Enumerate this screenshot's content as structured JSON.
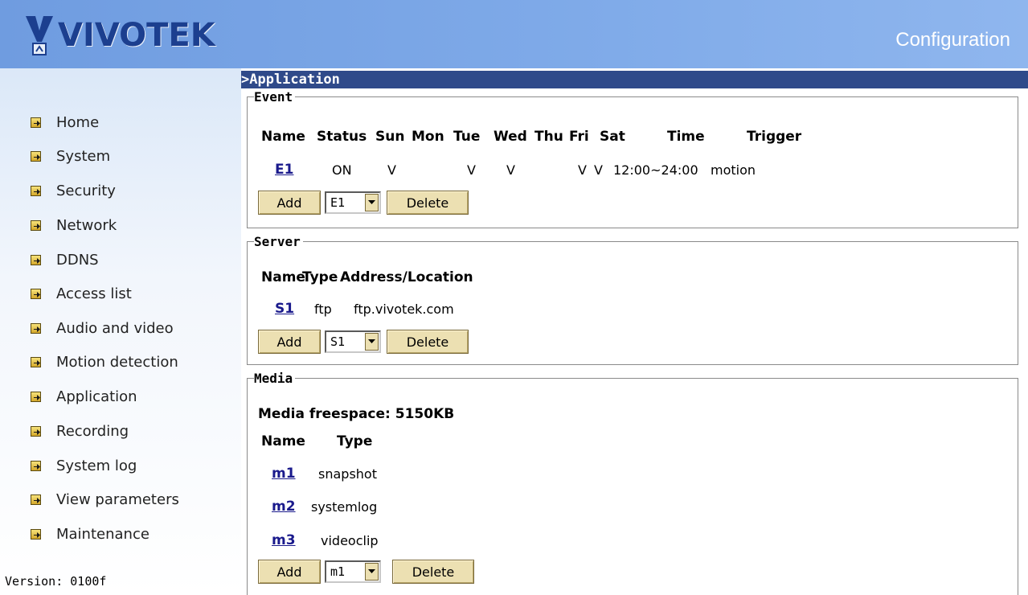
{
  "header": {
    "brand": "VIVOTEK",
    "title": "Configuration"
  },
  "sidebar": {
    "items": [
      {
        "label": "Home"
      },
      {
        "label": "System"
      },
      {
        "label": "Security"
      },
      {
        "label": "Network"
      },
      {
        "label": "DDNS"
      },
      {
        "label": "Access list"
      },
      {
        "label": "Audio and video"
      },
      {
        "label": "Motion detection"
      },
      {
        "label": "Application"
      },
      {
        "label": "Recording"
      },
      {
        "label": "System log"
      },
      {
        "label": "View parameters"
      },
      {
        "label": "Maintenance"
      }
    ],
    "version": "Version: 0100f"
  },
  "page": {
    "title": ">Application"
  },
  "event": {
    "legend": "Event",
    "headers": {
      "name": "Name",
      "status": "Status",
      "sun": "Sun",
      "mon": "Mon",
      "tue": "Tue",
      "wed": "Wed",
      "thu": "Thu",
      "fri": "Fri",
      "sat": "Sat",
      "time": "Time",
      "trigger": "Trigger"
    },
    "rows": [
      {
        "name": "E1",
        "status": "ON",
        "sun": "V",
        "mon": "",
        "tue": "V",
        "wed": "V",
        "thu": "",
        "fri": "V",
        "sat": "V",
        "time": "12:00~24:00",
        "trigger": "motion"
      }
    ],
    "add_label": "Add",
    "select_value": "E1",
    "delete_label": "Delete"
  },
  "server": {
    "legend": "Server",
    "headers": {
      "name": "Name",
      "type": "Type",
      "address": "Address/Location"
    },
    "rows": [
      {
        "name": "S1",
        "type": "ftp",
        "address": "ftp.vivotek.com"
      }
    ],
    "add_label": "Add",
    "select_value": "S1",
    "delete_label": "Delete"
  },
  "media": {
    "legend": "Media",
    "freespace": "Media freespace: 5150KB",
    "headers": {
      "name": "Name",
      "type": "Type"
    },
    "rows": [
      {
        "name": "m1",
        "type": "snapshot"
      },
      {
        "name": "m2",
        "type": "systemlog"
      },
      {
        "name": "m3",
        "type": "videoclip"
      }
    ],
    "add_label": "Add",
    "select_value": "m1",
    "delete_label": "Delete"
  },
  "colors": {
    "header_bg": "#7aa6e8",
    "title_bar": "#2f4a8a",
    "button_bg": "#ece0b2",
    "link": "#1a1a8c"
  }
}
